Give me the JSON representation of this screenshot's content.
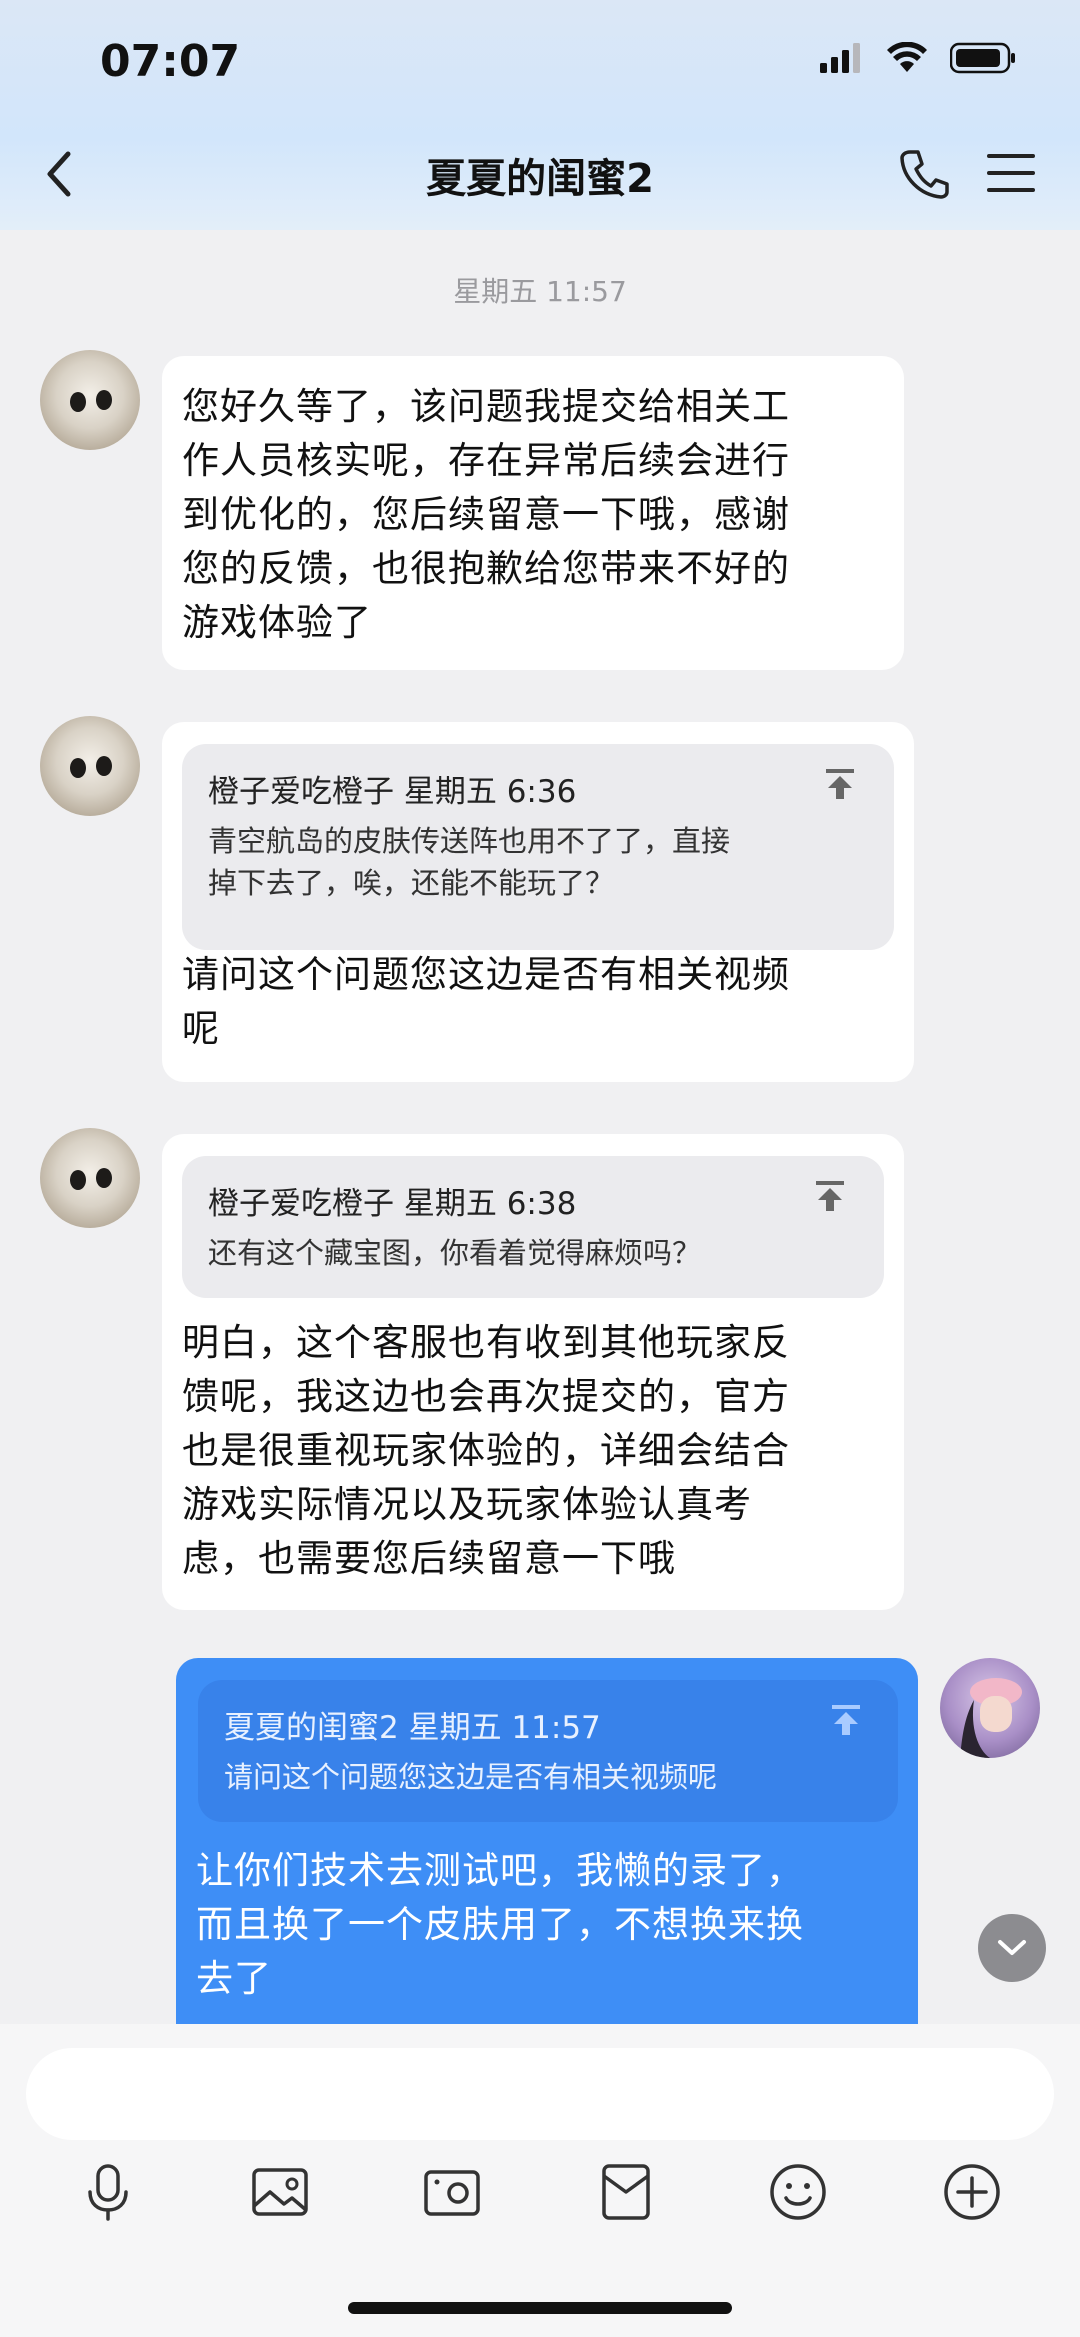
{
  "status_bar": {
    "time": "07:07"
  },
  "header": {
    "title": "夏夏的闺蜜2"
  },
  "timestamp": "星期五 11:57",
  "messages": [
    {
      "text_lines": [
        "您好久等了，该问题我提交给相关工",
        "作人员核实呢，存在异常后续会进行",
        "到优化的，您后续留意一下哦，感谢",
        "您的反馈，也很抱歉给您带来不好的",
        "游戏体验了"
      ]
    },
    {
      "quote": {
        "author": "橙子爱吃橙子",
        "time": "星期五 6:36",
        "lines": [
          "青空航岛的皮肤传送阵也用不了了，直接",
          "掉下去了，唉，还能不能玩了？"
        ]
      },
      "text_lines": [
        " 请问这个问题您这边是否有相关视频",
        "呢"
      ]
    },
    {
      "quote": {
        "author": "橙子爱吃橙子",
        "time": "星期五 6:38",
        "lines": [
          "还有这个藏宝图，你看着觉得麻烦吗？"
        ]
      },
      "text_lines": [
        "明白，这个客服也有收到其他玩家反",
        "馈呢，我这边也会再次提交的，官方",
        "也是很重视玩家体验的，详细会结合",
        "游戏实际情况以及玩家体验认真考",
        "虑，也需要您后续留意一下哦"
      ]
    },
    {
      "quote": {
        "author": "夏夏的闺蜜2",
        "time": "星期五 11:57",
        "lines": [
          " 请问这个问题您这边是否有相关视频呢"
        ]
      },
      "text_lines": [
        "让你们技术去测试吧，我懒的录了，",
        "而且换了一个皮肤用了，不想换来换",
        "去了"
      ]
    }
  ],
  "icons": [
    "back-icon",
    "phone-icon",
    "menu-icon",
    "pin-icon",
    "scroll-down-icon",
    "microphone-icon",
    "image-icon",
    "camera-icon",
    "red-packet-icon",
    "emoji-icon",
    "plus-icon"
  ],
  "colors": {
    "self_bubble": "#3e8ef6",
    "other_bubble": "#ffffff",
    "background": "#f0f0f2"
  }
}
